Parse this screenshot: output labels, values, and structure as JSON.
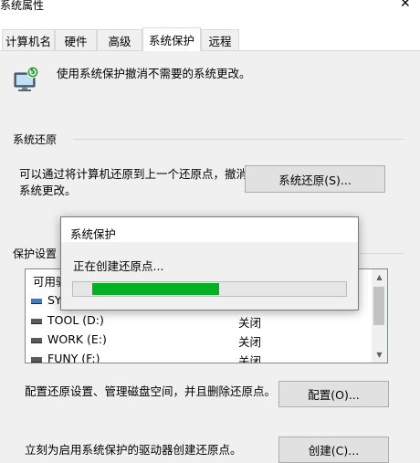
{
  "window": {
    "title": "系统属性"
  },
  "tabs": [
    {
      "label": "计算机名",
      "active": false
    },
    {
      "label": "硬件",
      "active": false
    },
    {
      "label": "高级",
      "active": false
    },
    {
      "label": "系统保护",
      "active": true
    },
    {
      "label": "远程",
      "active": false
    }
  ],
  "intro": {
    "text": "使用系统保护撤消不需要的系统更改。"
  },
  "restore": {
    "group_title": "系统还原",
    "description_line1": "可以通过将计算机还原到上一个还原点，撤消",
    "description_line2": "系统更改。",
    "button_label": "系统还原(S)..."
  },
  "protection": {
    "group_title": "保护设置",
    "list_header": "可用驱",
    "drives": [
      {
        "name": "SY",
        "status": "",
        "icon": "system-drive-icon"
      },
      {
        "name": "TOOL (D:)",
        "status": "关闭",
        "icon": "drive-icon"
      },
      {
        "name": "WORK (E:)",
        "status": "关闭",
        "icon": "drive-icon"
      },
      {
        "name": "FUNY (F:)",
        "status": "关闭",
        "icon": "drive-icon"
      }
    ],
    "configure_text": "配置还原设置、管理磁盘空间，并且删除还原点。",
    "configure_button": "配置(O)...",
    "create_text": "立刻为启用系统保护的驱动器创建还原点。",
    "create_button": "创建(C)..."
  },
  "dialog": {
    "title": "系统保护",
    "message": "正在创建还原点...",
    "progress_fraction": 0.5,
    "progress_color": "#06b025"
  }
}
